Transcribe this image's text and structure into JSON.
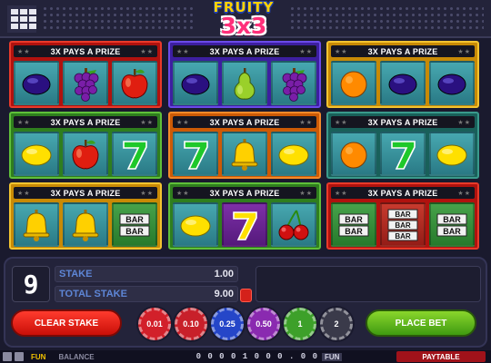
{
  "app": {
    "logo_top": "FRUITY",
    "logo_bottom": "3x3"
  },
  "games": [
    {
      "title": "3X PAYS A PRIZE",
      "color": "red",
      "symbols": [
        "plum",
        "grapes",
        "apple"
      ],
      "cell_bg": [
        "teal",
        "teal",
        "teal"
      ]
    },
    {
      "title": "3X PAYS A PRIZE",
      "color": "blue",
      "symbols": [
        "plum",
        "pear",
        "grapes"
      ],
      "cell_bg": [
        "teal",
        "teal",
        "teal"
      ]
    },
    {
      "title": "3X PAYS A PRIZE",
      "color": "yellow",
      "symbols": [
        "orange",
        "plum",
        "plum"
      ],
      "cell_bg": [
        "teal",
        "teal",
        "teal"
      ]
    },
    {
      "title": "3X PAYS A PRIZE",
      "color": "green",
      "symbols": [
        "lemon",
        "apple",
        "seven"
      ],
      "cell_bg": [
        "teal",
        "teal",
        "teal"
      ]
    },
    {
      "title": "3X PAYS A PRIZE",
      "color": "orange",
      "symbols": [
        "seven",
        "bell",
        "lemon"
      ],
      "cell_bg": [
        "teal",
        "teal",
        "teal"
      ]
    },
    {
      "title": "3X PAYS A PRIZE",
      "color": "teal",
      "symbols": [
        "orange",
        "seven",
        "lemon"
      ],
      "cell_bg": [
        "teal",
        "teal",
        "teal"
      ]
    },
    {
      "title": "3X PAYS A PRIZE",
      "color": "yellow",
      "symbols": [
        "bell",
        "bell",
        "bar2"
      ],
      "cell_bg": [
        "teal",
        "teal",
        "green"
      ]
    },
    {
      "title": "3X PAYS A PRIZE",
      "color": "green",
      "symbols": [
        "lemon",
        "seven",
        "cherry"
      ],
      "cell_bg": [
        "teal",
        "purple",
        "teal"
      ]
    },
    {
      "title": "3X PAYS A PRIZE",
      "color": "red",
      "symbols": [
        "bar2",
        "bar3",
        "bar2"
      ],
      "cell_bg": [
        "green",
        "red",
        "green"
      ]
    }
  ],
  "controls": {
    "stake_count": "9",
    "stake_label": "STAKE",
    "stake_value": "1.00",
    "total_stake_label": "TOTAL STAKE",
    "total_stake_value": "9.00",
    "clear_stake_label": "CLEAR STAKE",
    "place_bet_label": "PLACE BET",
    "chips": [
      {
        "label": "0.01",
        "color": "#d2202a"
      },
      {
        "label": "0.10",
        "color": "#c8202a"
      },
      {
        "label": "0.25",
        "color": "#2546c8"
      },
      {
        "label": "0.50",
        "color": "#8a2ab0"
      },
      {
        "label": "1",
        "color": "#3da02a"
      },
      {
        "label": "2",
        "color": "#3a3a4a"
      }
    ]
  },
  "status": {
    "fun_label": "FUN",
    "balance_label": "BALANCE",
    "balance_value": "0 0 0 0 1 0 0 0 . 0 0",
    "currency_label": "FUN",
    "paytable_label": "PAYTABLE"
  },
  "colors": {
    "red": "#b0120e",
    "blue": "#3d1fa0",
    "yellow": "#c88a06",
    "green": "#2f7e1e",
    "orange": "#cc5a06",
    "teal": "#19605a"
  }
}
